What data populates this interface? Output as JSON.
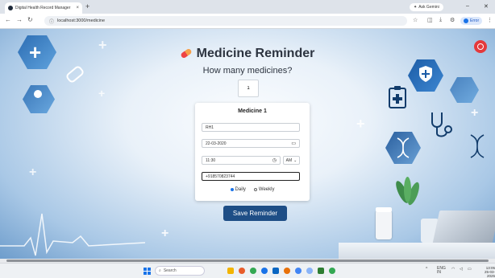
{
  "browser": {
    "tab_title": "Digital Health Record Manager",
    "tab_close": "×",
    "new_tab": "+",
    "url": "localhost:3000/medicine",
    "gemini_label": "Ask Gemini",
    "profile_label": "Error"
  },
  "page": {
    "title": "Medicine Reminder",
    "question": "How many medicines?",
    "count_value": "1"
  },
  "card": {
    "title": "Medicine 1",
    "name_value": "RH1",
    "date_value": "22-03-2020",
    "time_value": "11:30",
    "ampm_value": "AM",
    "phone_value": "+918570823744",
    "daily_label": "Daily",
    "weekly_label": "Weekly",
    "selected_frequency": "Daily"
  },
  "save_label": "Save Reminder",
  "taskbar": {
    "search_label": "Search",
    "lang": "ENG",
    "lang_sub": "IN",
    "time": "13:05",
    "date": "25-03-2025"
  },
  "colors": {
    "accent": "#1e4e86",
    "page_bg": "#a9c8e6",
    "hex_blue": "#2c6db3"
  }
}
